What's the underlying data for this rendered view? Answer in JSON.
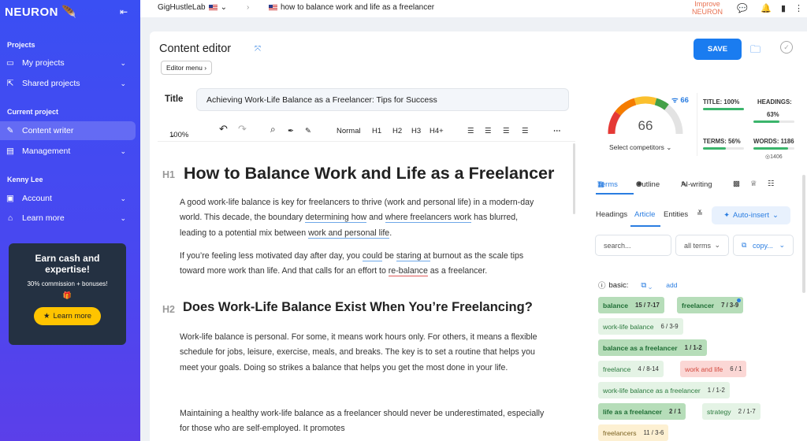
{
  "brand": "NEURON",
  "sidebar": {
    "projects_label": "Projects",
    "my_projects": "My projects",
    "shared_projects": "Shared projects",
    "current_project_label": "Current project",
    "content_writer": "Content writer",
    "management": "Management",
    "user_name": "Kenny Lee",
    "account": "Account",
    "learn_more": "Learn more",
    "promo_title": "Earn cash and expertise!",
    "promo_subtitle": "30% commission + bonuses!",
    "promo_button": "Learn more"
  },
  "topbar": {
    "project_name": "GigHustleLab",
    "document_name": "how to balance work and life as a freelancer",
    "improve_line1": "Improve",
    "improve_line2": "NEURON"
  },
  "editor": {
    "title": "Content editor",
    "save_label": "SAVE",
    "editor_menu": "Editor menu",
    "title_label": "Title",
    "title_value": "Achieving Work-Life Balance as a Freelancer: Tips for Success",
    "zoom": "100%",
    "normal": "Normal",
    "h1": "H1",
    "h2": "H2",
    "h3": "H3",
    "h4plus": "H4+",
    "heading1_tag": "H1",
    "heading1": "How to Balance Work and Life as a Freelancer",
    "p1_a": "A good work-life balance is key for freelancers to thrive (work and personal life) in a modern-day world. This decade, the boundary ",
    "p1_u1": "determining how",
    "p1_b": " and ",
    "p1_u2": "where freelancers work",
    "p1_c": " has blurred, leading to a potential mix between ",
    "p1_u3": "work and personal life",
    "p1_d": ".",
    "p2_a": "If you’re feeling less motivated day after day, you ",
    "p2_u1": "could",
    "p2_b": " be ",
    "p2_u2": "staring at",
    "p2_c": " burnout as the scale tips toward more work than life. And that calls for an effort to ",
    "p2_r1": "re-balance",
    "p2_d": " as a freelancer.",
    "heading2_tag": "H2",
    "heading2": "Does Work-Life Balance Exist When You’re Freelancing?",
    "p3": "Work-life balance is personal. For some, it means work hours only. For others, it means a flexible schedule for jobs, leisure, exercise, meals, and breaks. The key is to set a routine that helps you meet your goals. Doing so strikes a balance that helps you get the most done in your life.",
    "p4": "Maintaining a healthy work-life balance as a freelancer should never be underestimated, especially for those who are self-employed. It promotes"
  },
  "scores": {
    "content_score": "66",
    "competitor_score": "66",
    "select_competitors": "Select competitors",
    "title_stat": "TITLE: 100%",
    "title_pct": 1.0,
    "headings_label": "HEADINGS:",
    "headings_value": "63%",
    "headings_pct": 0.63,
    "terms_stat": "TERMS: 56%",
    "terms_pct": 0.56,
    "words_stat": "WORDS: 1186",
    "words_pct": 0.85,
    "words_target": "1406"
  },
  "panel": {
    "tab_terms": "Terms",
    "tab_outline": "Outline",
    "tab_ai": "AI-writing",
    "sub_headings": "Headings",
    "sub_article": "Article",
    "sub_entities": "Entities",
    "auto_insert": "Auto-insert",
    "search_placeholder": "search...",
    "all_terms": "all terms",
    "copy": "copy...",
    "basic_label": "basic:",
    "add_label": "add",
    "terms": [
      {
        "term": "balance",
        "count": "15 / 7-17",
        "style": "g"
      },
      {
        "term": "freelancer",
        "count": "7 / 3-9",
        "style": "g"
      },
      {
        "term": "work-life balance",
        "count": "6 / 3-9",
        "style": "lg"
      },
      {
        "term": "balance as a freelancer",
        "count": "1 / 1-2",
        "style": "g"
      },
      {
        "term": "freelance",
        "count": "4 / 8-14",
        "style": "lg"
      },
      {
        "term": "work and life",
        "count": "6 / 1",
        "style": "r"
      },
      {
        "term": "work-life balance as a freelancer",
        "count": "1 / 1-2",
        "style": "lg"
      },
      {
        "term": "life as a freelancer",
        "count": "2 / 1",
        "style": "g"
      },
      {
        "term": "strategy",
        "count": "2 / 1-7",
        "style": "lg"
      },
      {
        "term": "freelancers",
        "count": "11 / 3-6",
        "style": "y"
      }
    ]
  },
  "colors": {
    "accent": "#1a7cf0",
    "sidebar": "#3a4ff3",
    "good": "#3bb56b",
    "bad": "#d34a3f"
  }
}
